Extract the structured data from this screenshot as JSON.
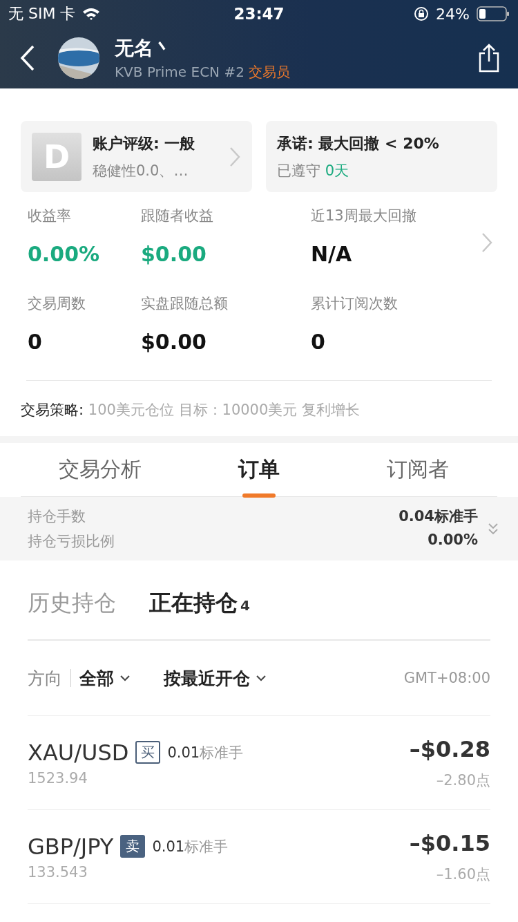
{
  "status_bar": {
    "carrier": "无 SIM 卡",
    "time": "23:47",
    "battery": "24%"
  },
  "header": {
    "name": "无名丶",
    "account": "KVB Prime ECN #2",
    "role": "交易员"
  },
  "cards": [
    {
      "kind": "rating",
      "grade": "D",
      "title": "账户评级: 一般",
      "subtitle": "稳健性0.0、…"
    },
    {
      "kind": "promise",
      "title": "承诺: 最大回撤 < 20%",
      "subtitle": "已遵守",
      "highlight": "0天"
    }
  ],
  "stats": [
    {
      "label": "收益率",
      "value": "0.00%",
      "color": "#1aaa7f"
    },
    {
      "label": "跟随者收益",
      "value": "$0.00",
      "color": "#1aaa7f"
    },
    {
      "label": "近13周最大回撤",
      "value": "N/A",
      "color": "#111111"
    },
    {
      "label": "交易周数",
      "value": "0",
      "color": "#111111"
    },
    {
      "label": "实盘跟随总额",
      "value": "$0.00",
      "color": "#111111"
    },
    {
      "label": "累计订阅次数",
      "value": "0",
      "color": "#111111"
    }
  ],
  "strategy": {
    "label": "交易策略:",
    "text": "100美元仓位 目标：10000美元 复利增长"
  },
  "tabs": [
    {
      "label": "交易分析",
      "selected": false
    },
    {
      "label": "订单",
      "selected": true
    },
    {
      "label": "订阅者",
      "selected": false
    }
  ],
  "summary": [
    {
      "label": "持仓手数",
      "value": "0.04标准手"
    },
    {
      "label": "持仓亏损比例",
      "value": "0.00%"
    }
  ],
  "subtabs": [
    {
      "label": "历史持仓",
      "selected": false
    },
    {
      "label": "正在持仓",
      "selected": true,
      "count": "4"
    }
  ],
  "filters": {
    "direction_label": "方向",
    "direction": "全部",
    "sort": "按最近开仓",
    "timezone": "GMT+08:00"
  },
  "orders": [
    {
      "symbol": "XAU/USD",
      "kind": "buy",
      "side": "买",
      "lots": "0.01",
      "unit": "标准手",
      "price": "1523.94",
      "profit": "–$0.28",
      "points": "–2.80点"
    },
    {
      "symbol": "GBP/JPY",
      "kind": "sell",
      "side": "卖",
      "lots": "0.01",
      "unit": "标准手",
      "price": "133.543",
      "profit": "–$0.15",
      "points": "–1.60点"
    }
  ]
}
